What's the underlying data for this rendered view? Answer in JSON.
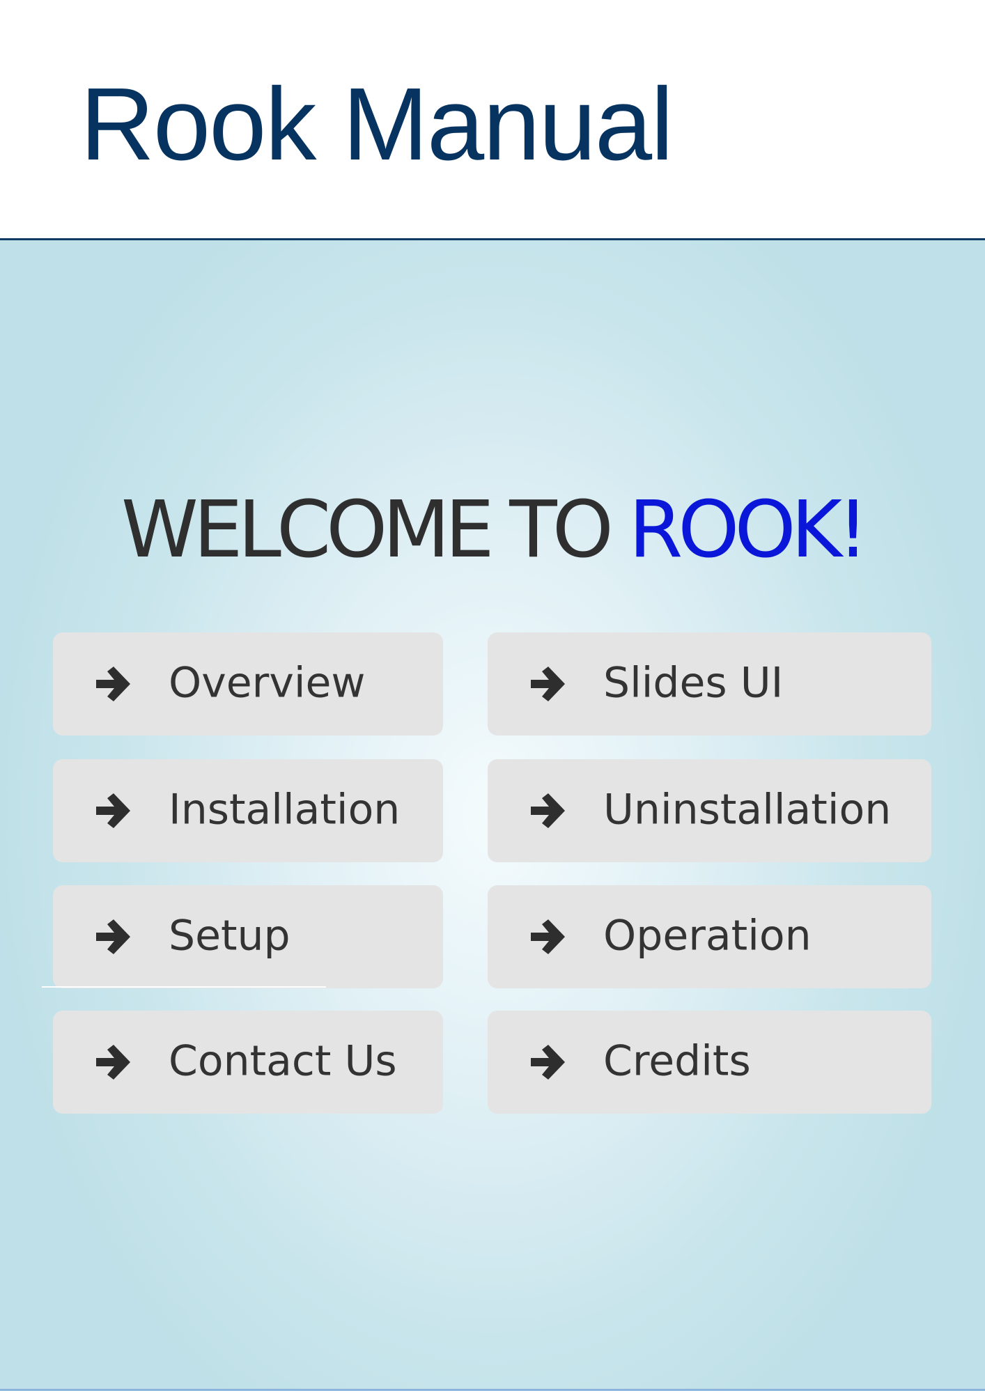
{
  "header": {
    "title": "Rook Manual"
  },
  "welcome": {
    "prefix": "WELCOME TO ",
    "accent": "ROOK",
    "suffix": "!"
  },
  "menu": {
    "items": [
      {
        "label": "Overview",
        "icon": "arrow-right-icon"
      },
      {
        "label": "Slides UI",
        "icon": "arrow-right-icon"
      },
      {
        "label": "Installation",
        "icon": "arrow-right-icon"
      },
      {
        "label": "Uninstallation",
        "icon": "arrow-right-icon"
      },
      {
        "label": "Setup",
        "icon": "arrow-right-icon"
      },
      {
        "label": "Operation",
        "icon": "arrow-right-icon"
      },
      {
        "label": "Contact Us",
        "icon": "arrow-right-icon"
      },
      {
        "label": "Credits",
        "icon": "arrow-right-icon"
      }
    ]
  },
  "colors": {
    "title": "#06335f",
    "accent": "#0a17d8",
    "text": "#333333",
    "button_bg": "#e4e4e4"
  }
}
